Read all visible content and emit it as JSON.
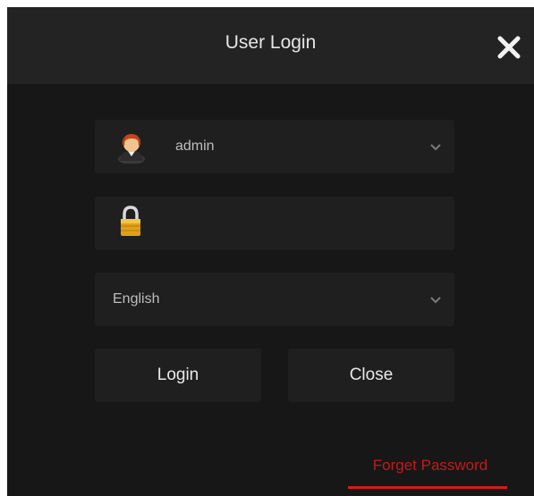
{
  "dialog": {
    "title": "User Login",
    "close_icon": "close-x-icon"
  },
  "user_field": {
    "value": "admin",
    "icon": "user-avatar-icon",
    "dropdown_icon": "chevron-down-icon"
  },
  "password_field": {
    "value": "",
    "icon": "padlock-icon"
  },
  "language_field": {
    "value": "English",
    "dropdown_icon": "chevron-down-icon"
  },
  "buttons": {
    "login_label": "Login",
    "close_label": "Close"
  },
  "forget_password": {
    "label": "Forget Password",
    "color": "#c21a1a"
  },
  "colors": {
    "background": "#171717",
    "titlebar": "#232323",
    "field": "#1f1f1f",
    "text": "#bdbdbd"
  }
}
